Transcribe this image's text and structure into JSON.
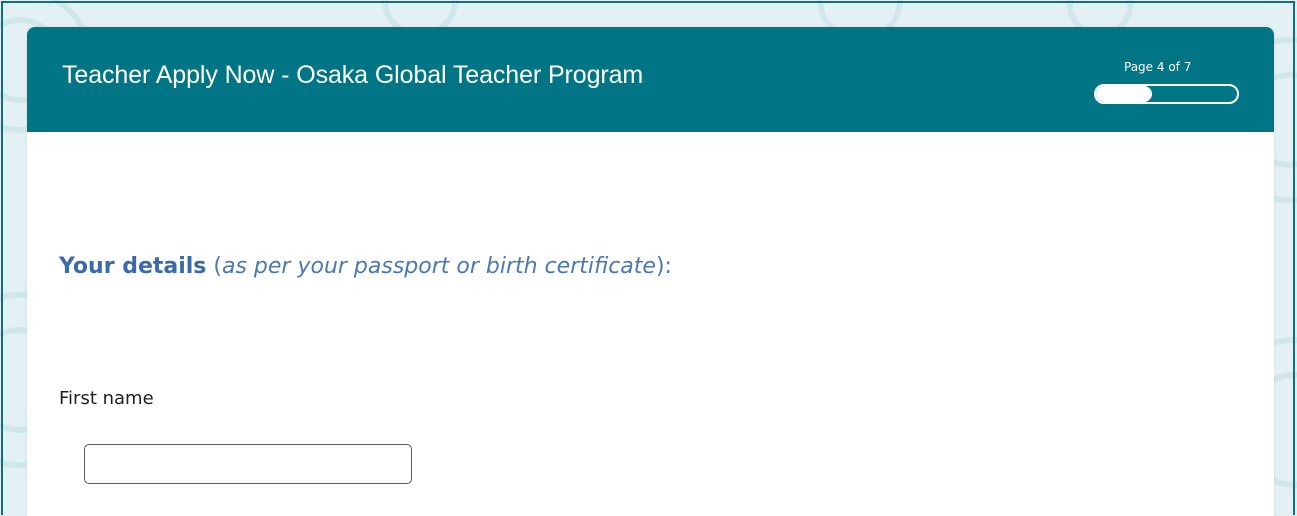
{
  "header": {
    "title": "Teacher Apply Now - Osaka Global Teacher Program",
    "page_indicator": "Page 4 of 7",
    "progress_fraction": 0.4
  },
  "section": {
    "title_strong": "Your details",
    "title_open": " (",
    "title_italic": "as per your passport or birth certificate",
    "title_close": "):"
  },
  "fields": {
    "first_name": {
      "label": "First name",
      "value": ""
    }
  },
  "colors": {
    "header_bg": "#007585",
    "section_title": "#4a78b3",
    "page_bg": "#e3f1f4"
  }
}
